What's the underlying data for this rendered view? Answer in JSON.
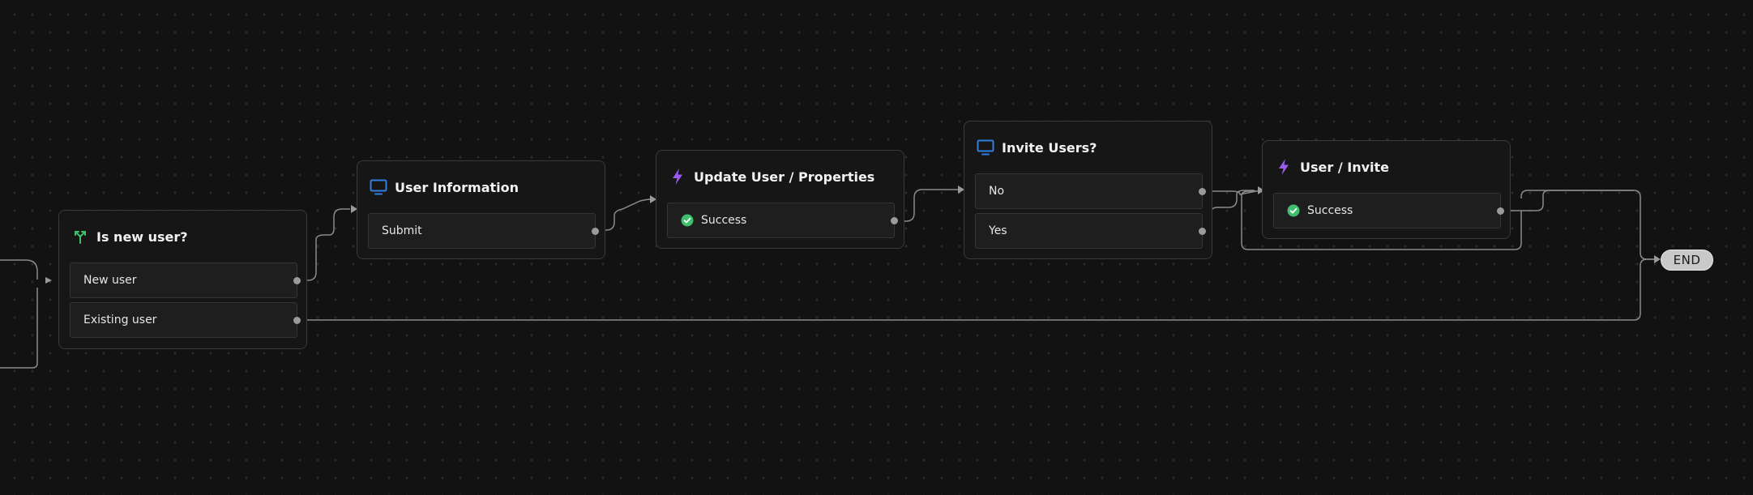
{
  "colors": {
    "background": "#121212",
    "node_border": "#3a3a3a",
    "edge": "#8a8a8a",
    "branch_icon": "#3fbf6e",
    "screen_icon": "#2f7fe0",
    "action_icon": "#9a5cf0",
    "success_icon": "#3fbf6e"
  },
  "nodes": [
    {
      "id": "is-new-user",
      "title": "Is new user?",
      "icon": "branch-icon",
      "ports": [
        {
          "label": "New user"
        },
        {
          "label": "Existing user"
        }
      ]
    },
    {
      "id": "user-information",
      "title": "User Information",
      "icon": "screen-icon",
      "ports": [
        {
          "label": "Submit"
        }
      ]
    },
    {
      "id": "update-user-properties",
      "title": "Update User / Properties",
      "icon": "lightning-icon",
      "ports": [
        {
          "label": "Success",
          "icon": "check-circle-icon"
        }
      ]
    },
    {
      "id": "invite-users",
      "title": "Invite Users?",
      "icon": "screen-icon",
      "ports": [
        {
          "label": "No"
        },
        {
          "label": "Yes"
        }
      ]
    },
    {
      "id": "user-invite",
      "title": "User / Invite",
      "icon": "lightning-icon",
      "ports": [
        {
          "label": "Success",
          "icon": "check-circle-icon"
        }
      ]
    }
  ],
  "end": {
    "label": "END"
  }
}
